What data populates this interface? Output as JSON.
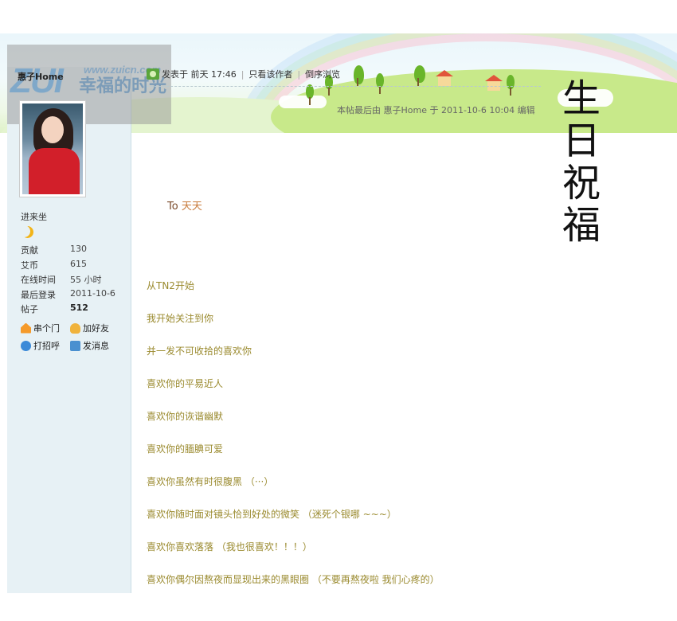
{
  "logo": {
    "mark": "ZUI",
    "url": "www.zuicn.com",
    "slogan": "幸福的时光"
  },
  "author": {
    "name": "惠子Home",
    "rank": "进来坐",
    "stats": [
      {
        "label": "贡献",
        "value": "130"
      },
      {
        "label": "艾币",
        "value": "615"
      },
      {
        "label": "在线时间",
        "value": "55 小时"
      },
      {
        "label": "最后登录",
        "value": "2011-10-6"
      },
      {
        "label": "帖子",
        "value": "512"
      }
    ],
    "actions": {
      "visit": "串个门",
      "add_friend": "加好友",
      "greet": "打招呼",
      "message": "发消息"
    }
  },
  "post": {
    "posted_prefix": "发表于",
    "posted_time": "前天 17:46",
    "only_author": "只看该作者",
    "reverse_view": "倒序浏览",
    "edited_note": "本帖最后由 惠子Home 于 2011-10-6 10:04 编辑",
    "title_vertical": [
      "生",
      "日",
      "祝",
      "福"
    ],
    "to_prefix": "To",
    "to_name": "天天",
    "lines": [
      "从TN2开始",
      "我开始关注到你",
      "并一发不可收拾的喜欢你",
      "喜欢你的平易近人",
      "喜欢你的诙谐幽默",
      "喜欢你的腼腆可爱",
      "喜欢你虽然有时很腹黑  （···）",
      "喜欢你随时面对镜头恰到好处的微笑  （迷死个银哪 ~~~）",
      "喜欢你喜欢落落  （我也很喜欢！！！）",
      "喜欢你偶尔因熬夜而显现出来的黑眼圈  （不要再熬夜啦 我们心疼的）"
    ]
  },
  "colors": {
    "sidebar_bg": "#e7f1f5",
    "body_text": "#9a8a2e",
    "to_name": "#c87a3a"
  }
}
